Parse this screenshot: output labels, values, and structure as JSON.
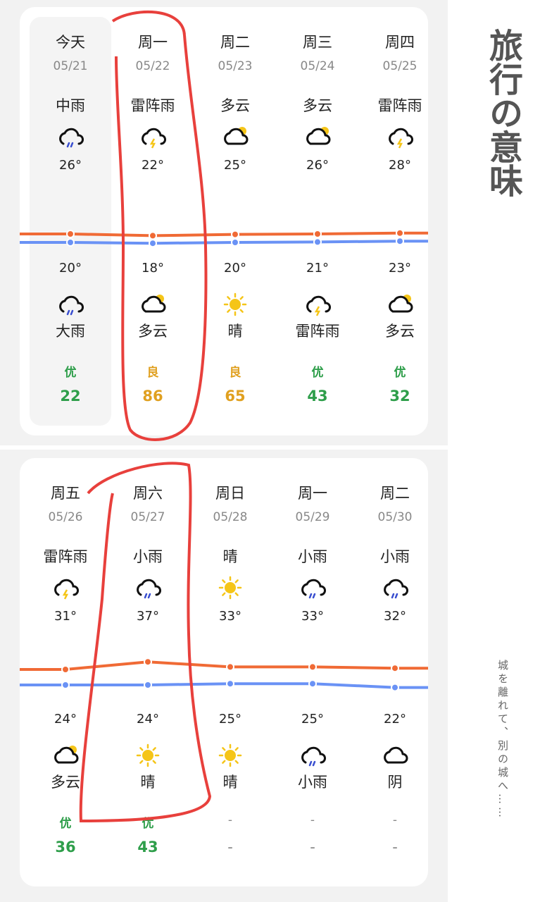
{
  "colors": {
    "good": "#2e9e4a",
    "moderate": "#e0a020",
    "high_line": "#f06a35",
    "low_line": "#6a92f5",
    "annotation": "#e8403c"
  },
  "title": "旅行の意味",
  "subtitle": "城を離れて、別の城へ……",
  "cards": [
    {
      "days": [
        {
          "weekday": "今天",
          "date": "05/21",
          "day_weather": "中雨",
          "day_icon": "rain",
          "high": "26°",
          "low": "20°",
          "night_icon": "rain",
          "night_weather": "大雨",
          "aqi_label": "优",
          "aqi_value": "22",
          "aqi_level": "good"
        },
        {
          "weekday": "周一",
          "date": "05/22",
          "day_weather": "雷阵雨",
          "day_icon": "thunder",
          "high": "22°",
          "low": "18°",
          "night_icon": "partly-cloudy",
          "night_weather": "多云",
          "aqi_label": "良",
          "aqi_value": "86",
          "aqi_level": "moderate"
        },
        {
          "weekday": "周二",
          "date": "05/23",
          "day_weather": "多云",
          "day_icon": "partly-cloudy",
          "high": "25°",
          "low": "20°",
          "night_icon": "sun",
          "night_weather": "晴",
          "aqi_label": "良",
          "aqi_value": "65",
          "aqi_level": "moderate"
        },
        {
          "weekday": "周三",
          "date": "05/24",
          "day_weather": "多云",
          "day_icon": "partly-cloudy",
          "high": "26°",
          "low": "21°",
          "night_icon": "thunder",
          "night_weather": "雷阵雨",
          "aqi_label": "优",
          "aqi_value": "43",
          "aqi_level": "good"
        },
        {
          "weekday": "周四",
          "date": "05/25",
          "day_weather": "雷阵雨",
          "day_icon": "thunder",
          "high": "28°",
          "low": "23°",
          "night_icon": "partly-cloudy",
          "night_weather": "多云",
          "aqi_label": "优",
          "aqi_value": "32",
          "aqi_level": "good"
        }
      ]
    },
    {
      "days": [
        {
          "weekday": "周五",
          "date": "05/26",
          "day_weather": "雷阵雨",
          "day_icon": "thunder",
          "high": "31°",
          "low": "24°",
          "night_icon": "partly-cloudy",
          "night_weather": "多云",
          "aqi_label": "优",
          "aqi_value": "36",
          "aqi_level": "good"
        },
        {
          "weekday": "周六",
          "date": "05/27",
          "day_weather": "小雨",
          "day_icon": "rain",
          "high": "37°",
          "low": "24°",
          "night_icon": "sun",
          "night_weather": "晴",
          "aqi_label": "优",
          "aqi_value": "43",
          "aqi_level": "good"
        },
        {
          "weekday": "周日",
          "date": "05/28",
          "day_weather": "晴",
          "day_icon": "sun",
          "high": "33°",
          "low": "25°",
          "night_icon": "sun",
          "night_weather": "晴",
          "aqi_label": "-",
          "aqi_value": "-",
          "aqi_level": "none"
        },
        {
          "weekday": "周一",
          "date": "05/29",
          "day_weather": "小雨",
          "day_icon": "rain",
          "high": "33°",
          "low": "25°",
          "night_icon": "rain",
          "night_weather": "小雨",
          "aqi_label": "-",
          "aqi_value": "-",
          "aqi_level": "none"
        },
        {
          "weekday": "周二",
          "date": "05/30",
          "day_weather": "小雨",
          "day_icon": "rain",
          "high": "32°",
          "low": "22°",
          "night_icon": "cloudy",
          "night_weather": "阴",
          "aqi_label": "-",
          "aqi_value": "-",
          "aqi_level": "none"
        }
      ]
    }
  ]
}
